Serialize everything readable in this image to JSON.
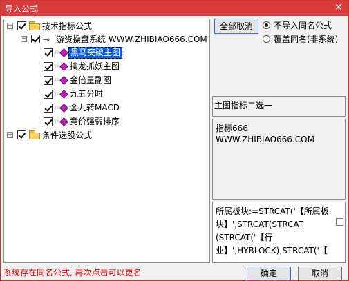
{
  "window": {
    "title": "导入公式",
    "close_glyph": "✕"
  },
  "tree": {
    "root1": {
      "label": "技术指标公式"
    },
    "child": {
      "label": "游资操盘系统 WWW.ZHIBIAO666.COM"
    },
    "items": [
      {
        "label": "黑马突破主图",
        "selected": true
      },
      {
        "label": "擒龙抓妖主图"
      },
      {
        "label": "金倍量副图"
      },
      {
        "label": "九五分时"
      },
      {
        "label": "金九转MACD"
      },
      {
        "label": "竞价强弱排序"
      }
    ],
    "root2": {
      "label": "条件选股公式"
    }
  },
  "controls": {
    "cancel_all_label": "全部取消",
    "radio_no_import": "不导入同名公式",
    "radio_overwrite": "覆盖同名(非系统)",
    "radio_selected": "no_import"
  },
  "info": {
    "line1": "主图指标二选一",
    "desc1": "指标666",
    "desc2": "WWW.ZHIBIAO666.COM",
    "code1": "所属板块:=STRCAT('【所属板",
    "code2": "块】',STRCAT(STRCAT",
    "code3": "(STRCAT('【行",
    "code4": "业】',HYBLOCK),STRCAT('【"
  },
  "footer": {
    "status": "系统存在同名公式, 再次点击可以更名",
    "ok_label": "确定",
    "cancel_label": "取消"
  }
}
